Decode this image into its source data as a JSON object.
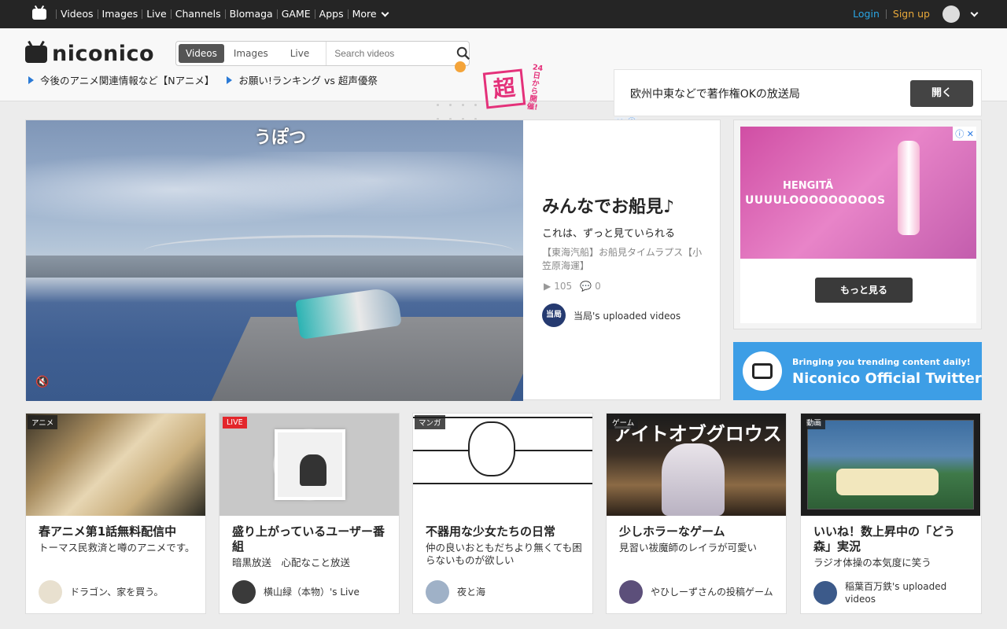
{
  "topnav": {
    "links": [
      "Videos",
      "Images",
      "Live",
      "Channels",
      "Blomaga",
      "GAME",
      "Apps"
    ],
    "more_label": "More",
    "login": "Login",
    "signup": "Sign up"
  },
  "header": {
    "brand": "niconico",
    "search": {
      "tabs": [
        "Videos",
        "Images",
        "Live"
      ],
      "active_tab": "Videos",
      "placeholder": "Search videos"
    },
    "links": [
      "今後のアニメ関連情報など【Nアニメ】",
      "お願い!ランキング vs 超声優祭"
    ],
    "promo": {
      "big_char": "超",
      "side_text": "24日から開催!"
    },
    "ad": {
      "text": "欧州中東などで著作権OKの放送局",
      "button": "開く"
    }
  },
  "hero": {
    "video_caption": "うぽつ",
    "title": "みんなでお船見♪",
    "subtitle": "これは、ずっと見ていられる",
    "description": "【東海汽船】お船見タイムラプス【小笠原海運】",
    "views": "105",
    "comments": "0",
    "owner_icon_text": "当局",
    "owner": "当局's uploaded videos"
  },
  "side_ad": {
    "line1": "HENGITÄ",
    "line2": "UUUULOOOOOOOOOS",
    "button": "もっと見る"
  },
  "twitter": {
    "line1": "Bringing you trending content daily!",
    "line2": "Niconico Official Twitter"
  },
  "cards": [
    {
      "badge": "アニメ",
      "title": "春アニメ第1話無料配信中",
      "desc": "トーマス民救済と噂のアニメです。",
      "owner": "ドラゴン、家を買う。",
      "avatar_color": "#e8e0cf"
    },
    {
      "badge": "LIVE",
      "title": "盛り上がっているユーザー番組",
      "desc": "暗黒放送　心配なこと放送",
      "owner": "横山緑（本物）'s Live",
      "avatar_color": "#3a3a3a"
    },
    {
      "badge": "マンガ",
      "title": "不器用な少女たちの日常",
      "desc": "仲の良いおともだちより無くても困らないものが欲しい",
      "owner": "夜と海",
      "avatar_color": "#9fb1c7"
    },
    {
      "badge": "ゲーム",
      "title": "少しホラーなゲーム",
      "desc": "見習い祓魔師のレイラが可愛い",
      "owner": "やひしーずさんの投稿ゲーム",
      "avatar_color": "#5c4f7a",
      "thumb_text": "アイトオブグロウス"
    },
    {
      "badge": "動画",
      "title": "いいね！数上昇中の「どう森」実況",
      "desc": "ラジオ体操の本気度に笑う",
      "owner": "稲葉百万鉄's uploaded videos",
      "avatar_color": "#3c5a8a"
    }
  ]
}
